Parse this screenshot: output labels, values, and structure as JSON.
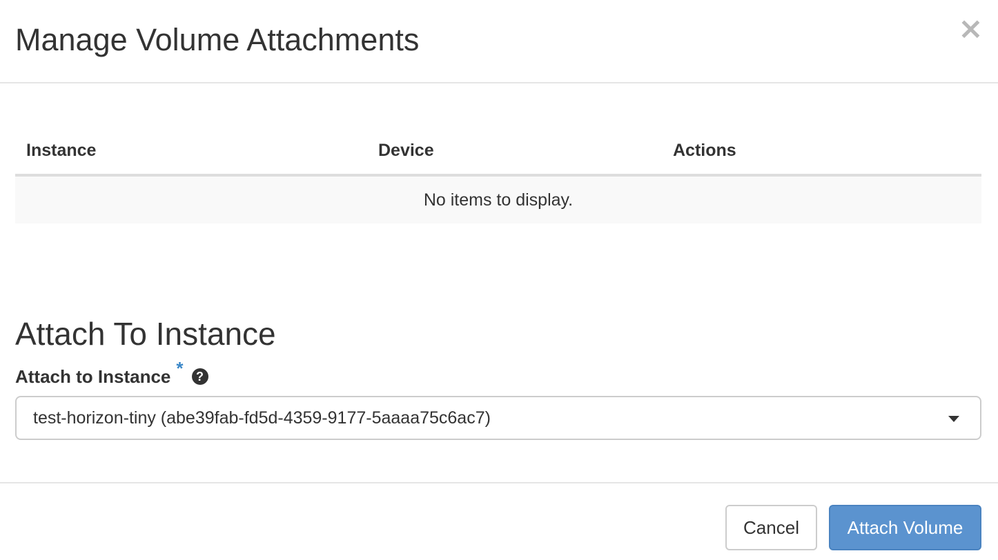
{
  "modal": {
    "title": "Manage Volume Attachments",
    "close_label": "×"
  },
  "attachments_table": {
    "columns": [
      "Instance",
      "Device",
      "Actions"
    ],
    "empty_message": "No items to display."
  },
  "attach_section": {
    "title": "Attach To Instance",
    "field_label": "Attach to Instance",
    "required_mark": "*",
    "help_icon_glyph": "?",
    "selected_instance": "test-horizon-tiny (abe39fab-fd5d-4359-9177-5aaaa75c6ac7)"
  },
  "footer": {
    "cancel_label": "Cancel",
    "submit_label": "Attach Volume"
  },
  "colors": {
    "primary": "#5b93cf",
    "required": "#3a87c8"
  }
}
